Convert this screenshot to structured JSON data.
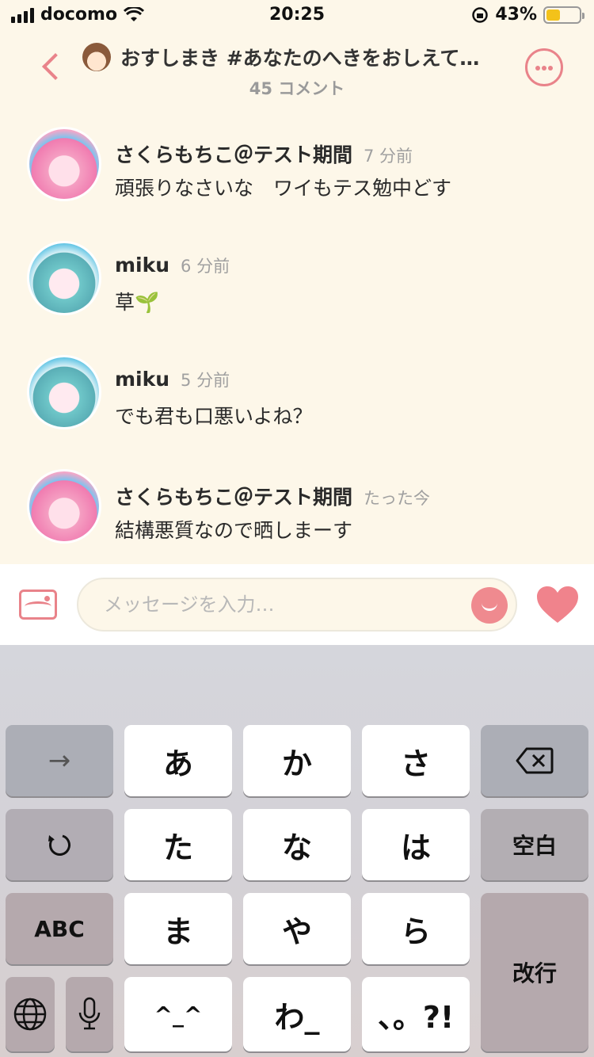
{
  "status_bar": {
    "carrier": "docomo",
    "time": "20:25",
    "battery": "43%",
    "battery_level": 0.43
  },
  "header": {
    "title": "おすしまき #あなたのへきをおしえて…",
    "subtitle": "45 コメント",
    "back_icon": "chevron-left-icon",
    "menu_icon": "more-icon"
  },
  "comments": [
    {
      "name": "さくらもちこ＠テスト期間",
      "time": "7 分前",
      "text": "頑張りなさいな　ワイもテス勉中どす"
    },
    {
      "name": "miku",
      "time": "6 分前",
      "text": "草🌱"
    },
    {
      "name": "miku",
      "time": "5 分前",
      "text": "でも君も口悪いよね？"
    },
    {
      "name": "さくらもちこ＠テスト期間",
      "time": "たった今",
      "text": "結構悪質なので晒しまーす"
    }
  ],
  "input": {
    "placeholder": "メッセージを入力…",
    "value": ""
  },
  "keyboard": {
    "arrow": "→",
    "a": "あ",
    "ka": "か",
    "sa": "さ",
    "ta": "た",
    "na": "な",
    "ha": "は",
    "space": "空白",
    "abc": "ABC",
    "ma": "ま",
    "ya": "や",
    "ra": "ら",
    "enter": "改行",
    "kaomoji": "^_^",
    "wa": "わ_",
    "punct": "、。?!"
  },
  "colors": {
    "accent": "#e9838a",
    "background": "#fdf7e9",
    "battery": "#f3c21a"
  }
}
